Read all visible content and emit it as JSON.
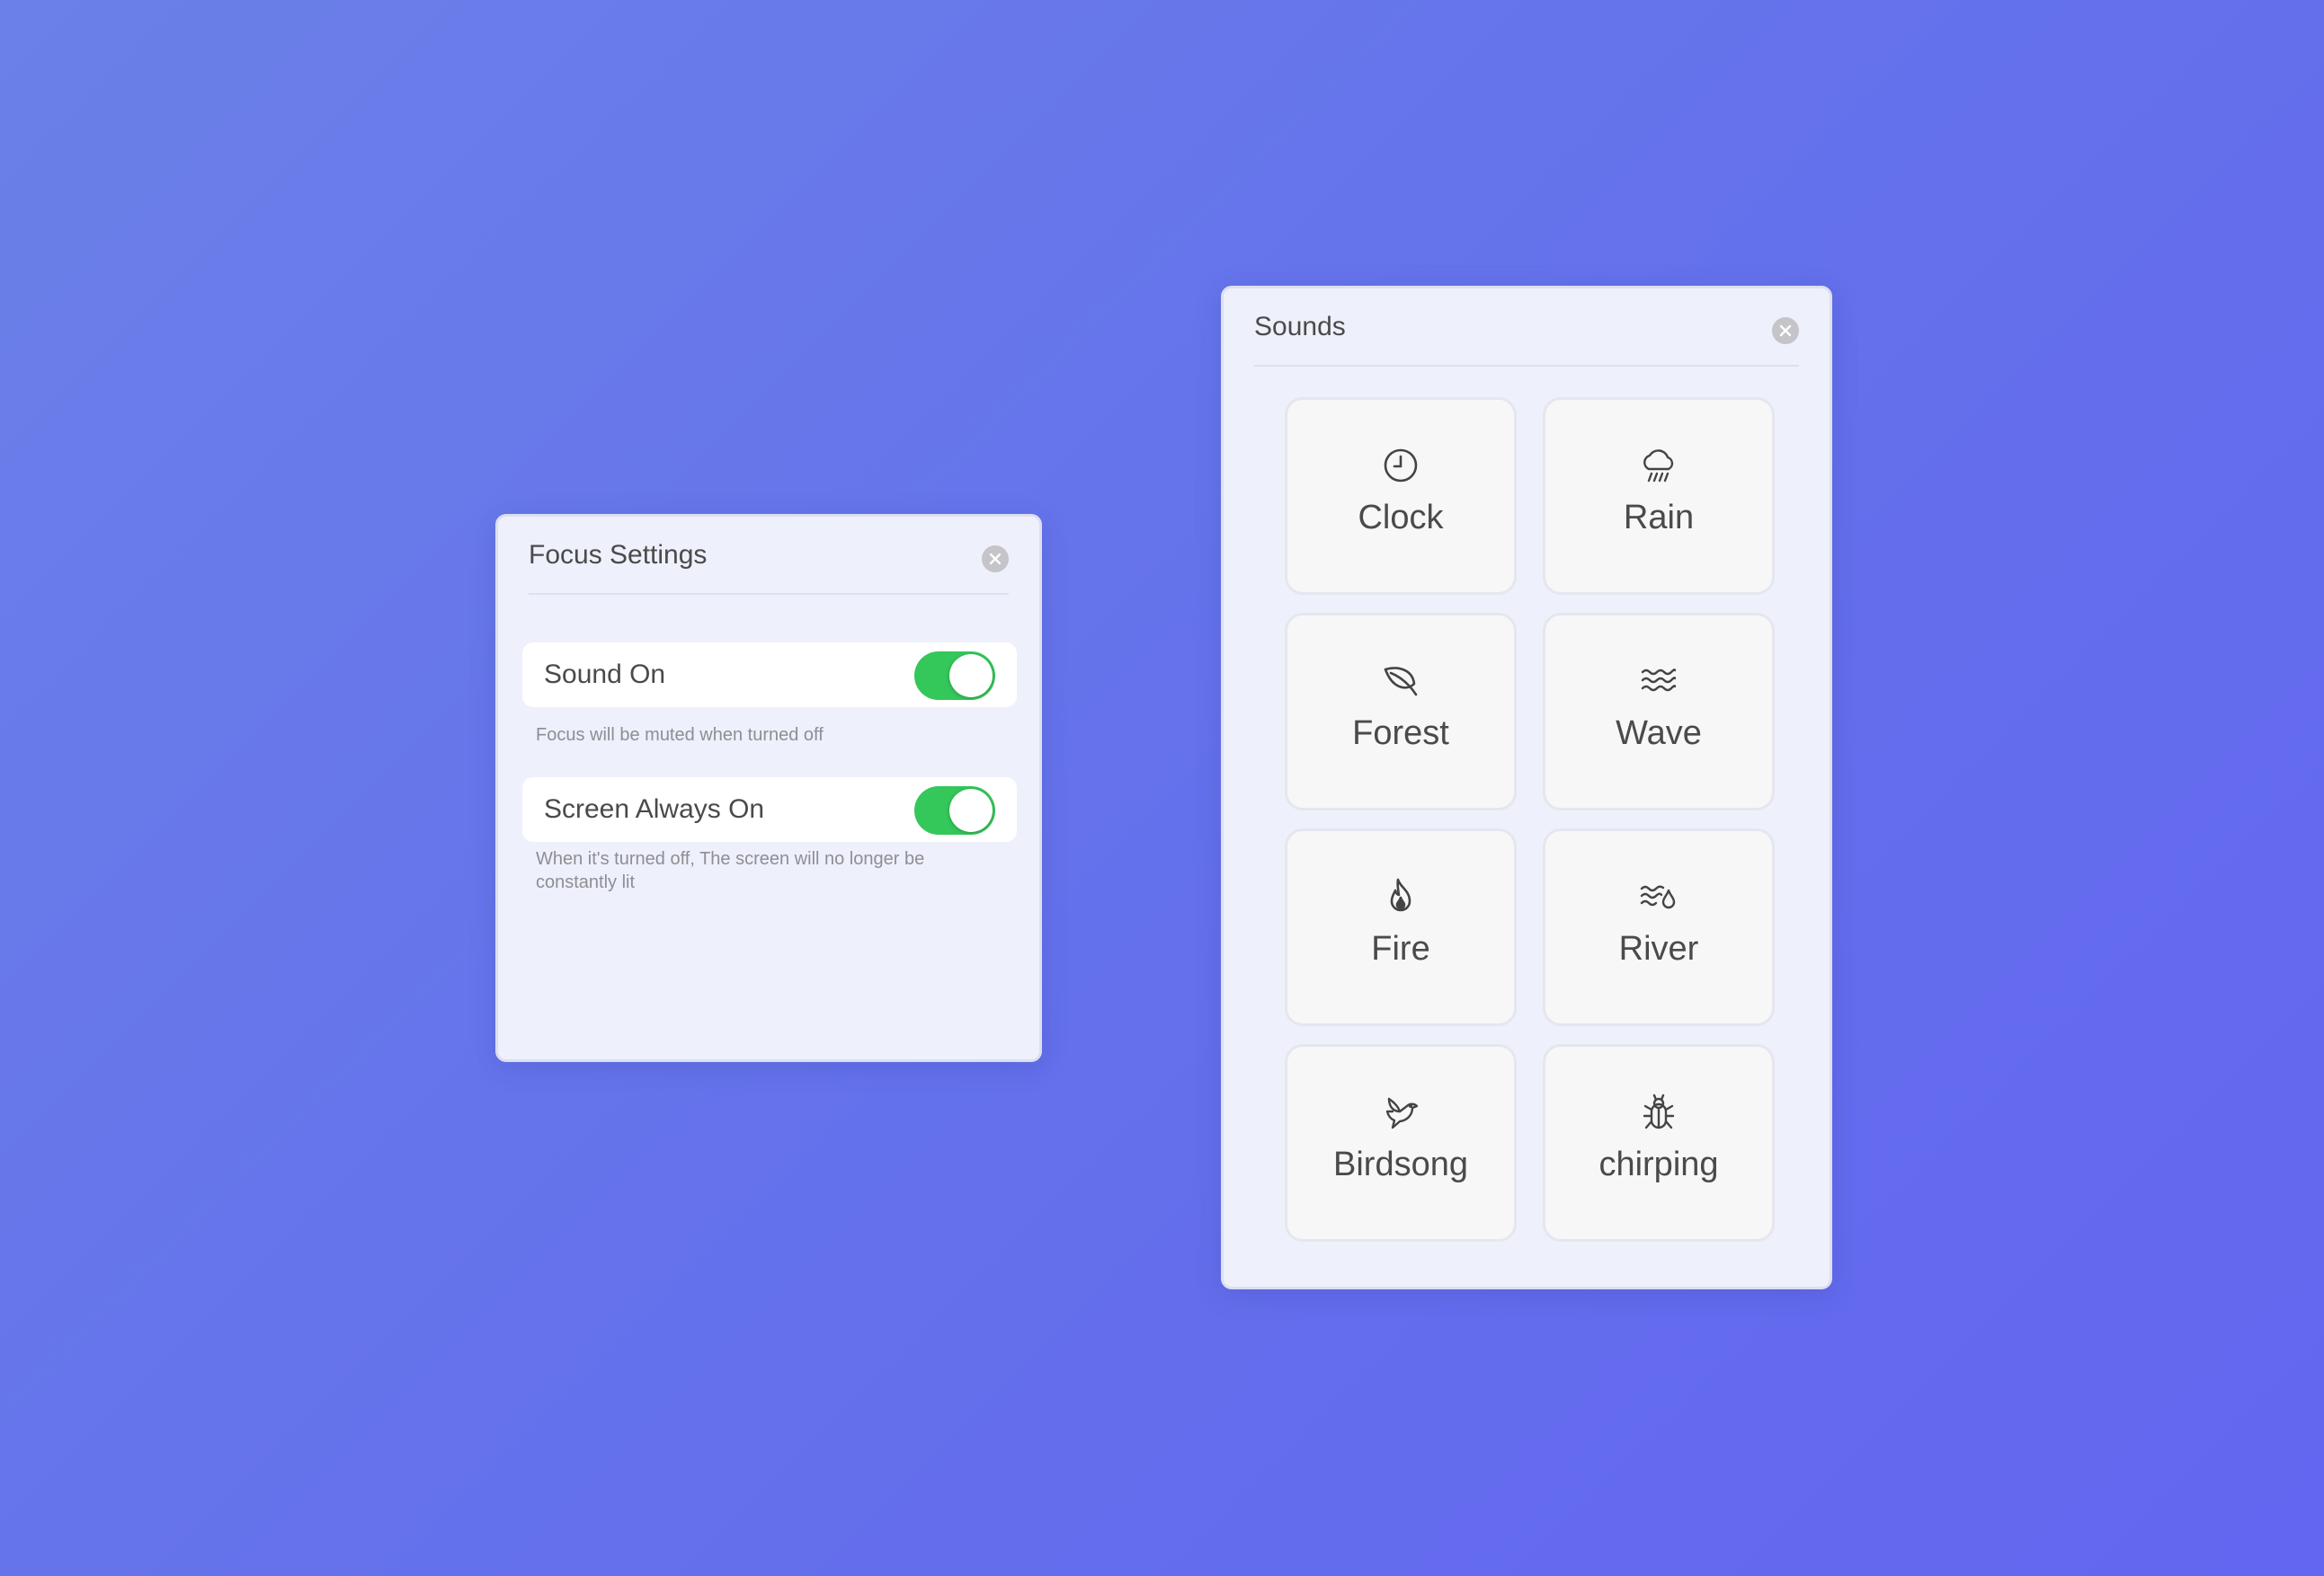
{
  "focus_settings": {
    "title": "Focus Settings",
    "sound_on": {
      "label": "Sound On",
      "enabled": true,
      "hint": "Focus will be muted when turned off"
    },
    "screen_always_on": {
      "label": "Screen Always On",
      "enabled": true,
      "hint": "When it's turned off, The screen will no longer be constantly lit"
    }
  },
  "sounds": {
    "title": "Sounds",
    "tiles": [
      {
        "label": "Clock",
        "icon": "clock-icon"
      },
      {
        "label": "Rain",
        "icon": "rain-icon"
      },
      {
        "label": "Forest",
        "icon": "leaf-icon"
      },
      {
        "label": "Wave",
        "icon": "wave-icon"
      },
      {
        "label": "Fire",
        "icon": "flame-icon"
      },
      {
        "label": "River",
        "icon": "river-icon"
      },
      {
        "label": "Birdsong",
        "icon": "bird-icon"
      },
      {
        "label": "chirping",
        "icon": "bug-icon"
      }
    ]
  },
  "colors": {
    "background": "#6470ec",
    "panel": "#eef0fb",
    "toggle_on": "#34c759",
    "tile": "#f7f7f8",
    "text": "#4a4a4a",
    "hint_text": "#8e8e93"
  }
}
